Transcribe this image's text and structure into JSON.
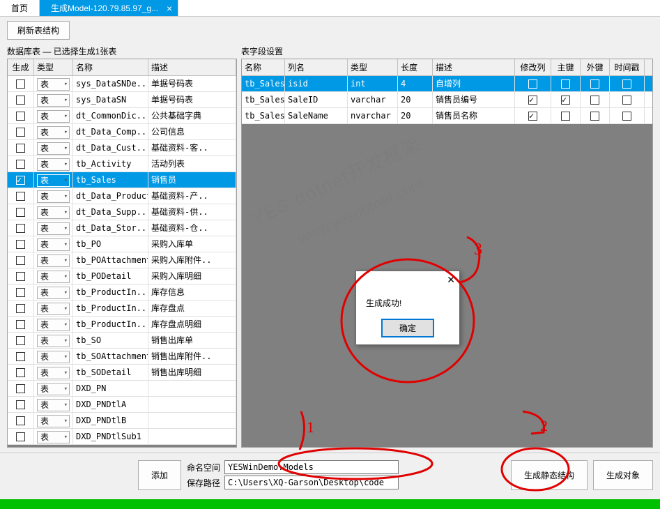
{
  "tabs": {
    "home": "首页",
    "active": "生成Model-120.79.85.97_g..."
  },
  "topbar": {
    "refresh": "刷新表结构"
  },
  "left": {
    "label": "数据库表 — 已选择生成1张表",
    "headers": [
      "生成",
      "类型",
      "名称",
      "描述"
    ],
    "type_label": "表",
    "rows": [
      {
        "chk": false,
        "name": "sys_DataSNDe..",
        "desc": "单据号码表"
      },
      {
        "chk": false,
        "name": "sys_DataSN",
        "desc": "单据号码表"
      },
      {
        "chk": false,
        "name": "dt_CommonDic..",
        "desc": "公共基础字典"
      },
      {
        "chk": false,
        "name": "dt_Data_Comp..",
        "desc": "公司信息"
      },
      {
        "chk": false,
        "name": "dt_Data_Cust..",
        "desc": "基础资料-客.."
      },
      {
        "chk": false,
        "name": "tb_Activity",
        "desc": "活动列表"
      },
      {
        "chk": true,
        "name": "tb_Sales",
        "desc": "销售员",
        "sel": true
      },
      {
        "chk": false,
        "name": "dt_Data_Product",
        "desc": "基础资料-产.."
      },
      {
        "chk": false,
        "name": "dt_Data_Supp..",
        "desc": "基础资料-供.."
      },
      {
        "chk": false,
        "name": "dt_Data_Stor..",
        "desc": "基础资料-仓.."
      },
      {
        "chk": false,
        "name": "tb_PO",
        "desc": "采购入库单"
      },
      {
        "chk": false,
        "name": "tb_POAttachment",
        "desc": "采购入库附件.."
      },
      {
        "chk": false,
        "name": "tb_PODetail",
        "desc": "采购入库明细"
      },
      {
        "chk": false,
        "name": "tb_ProductIn..",
        "desc": "库存信息"
      },
      {
        "chk": false,
        "name": "tb_ProductIn..",
        "desc": "库存盘点"
      },
      {
        "chk": false,
        "name": "tb_ProductIn..",
        "desc": "库存盘点明细"
      },
      {
        "chk": false,
        "name": "tb_SO",
        "desc": "销售出库单"
      },
      {
        "chk": false,
        "name": "tb_SOAttachment",
        "desc": "销售出库附件.."
      },
      {
        "chk": false,
        "name": "tb_SODetail",
        "desc": "销售出库明细"
      },
      {
        "chk": false,
        "name": "DXD_PN",
        "desc": ""
      },
      {
        "chk": false,
        "name": "DXD_PNDtlA",
        "desc": ""
      },
      {
        "chk": false,
        "name": "DXD_PNDtlB",
        "desc": ""
      },
      {
        "chk": false,
        "name": "DXD_PNDtlSub1",
        "desc": ""
      }
    ]
  },
  "right": {
    "label": "表字段设置",
    "headers": [
      "名称",
      "列名",
      "类型",
      "长度",
      "描述",
      "修改列",
      "主键",
      "外键",
      "时间戳"
    ],
    "rows": [
      {
        "name": "tb_Sales",
        "col": "isid",
        "type": "int",
        "len": "4",
        "desc": "自增列",
        "mod": false,
        "pk": false,
        "fk": false,
        "ts": false,
        "sel": true
      },
      {
        "name": "tb_Sales",
        "col": "SaleID",
        "type": "varchar",
        "len": "20",
        "desc": "销售员编号",
        "mod": true,
        "pk": true,
        "fk": false,
        "ts": false
      },
      {
        "name": "tb_Sales",
        "col": "SaleName",
        "type": "nvarchar",
        "len": "20",
        "desc": "销售员名称",
        "mod": true,
        "pk": false,
        "fk": false,
        "ts": false
      }
    ]
  },
  "bottom": {
    "add": "添加",
    "ns_label": "命名空间",
    "ns_value": "YESWinDemo.Models",
    "path_label": "保存路径",
    "path_value": "C:\\Users\\XQ-Garson\\Desktop\\code",
    "gen_static": "生成静态结构",
    "gen_obj": "生成对象"
  },
  "dialog": {
    "msg": "生成成功!",
    "ok": "确定"
  },
  "watermark": {
    "l1": "YES dotnet开发框架",
    "l2": "www.yesdotnet.com"
  }
}
